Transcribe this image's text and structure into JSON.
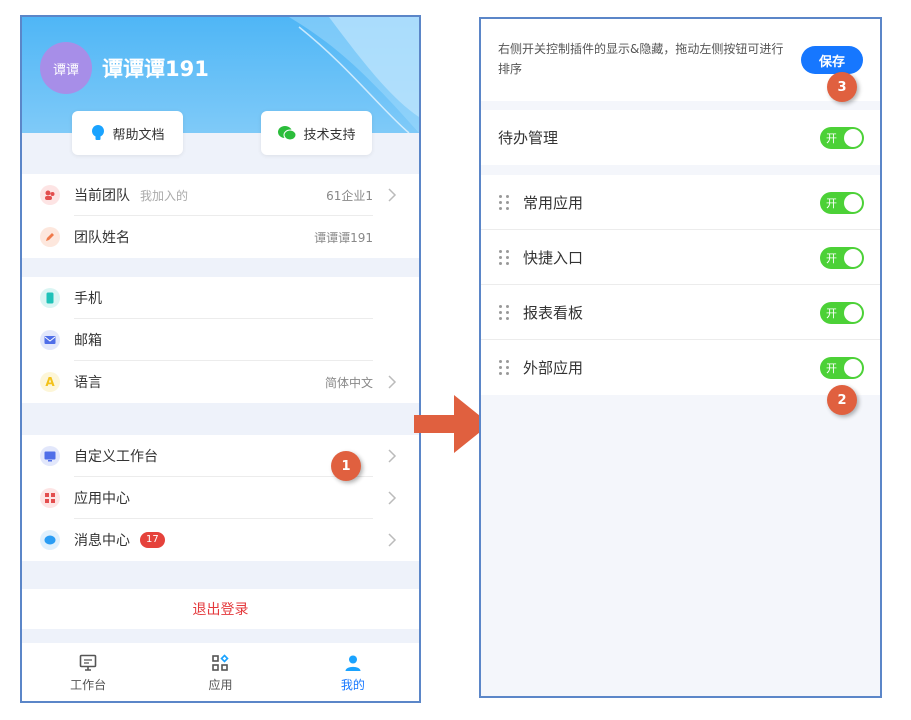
{
  "left": {
    "user": {
      "avatar_text": "谭谭",
      "name": "谭谭谭191"
    },
    "help": {
      "docs": "帮助文档",
      "support": "技术支持"
    },
    "team": [
      {
        "label": "当前团队",
        "sub": "我加入的",
        "value": "61企业1"
      },
      {
        "label": "团队姓名",
        "value": "谭谭谭191"
      }
    ],
    "contact": [
      {
        "label": "手机"
      },
      {
        "label": "邮箱"
      },
      {
        "label": "语言",
        "value": "简体中文"
      }
    ],
    "apps": [
      {
        "label": "自定义工作台"
      },
      {
        "label": "应用中心"
      },
      {
        "label": "消息中心",
        "badge": "17"
      }
    ],
    "logout": "退出登录",
    "tabs": [
      {
        "label": "工作台",
        "icon": "monitor-icon"
      },
      {
        "label": "应用",
        "icon": "grid-icon"
      },
      {
        "label": "我的",
        "icon": "user-icon",
        "active": true
      }
    ]
  },
  "markers": {
    "m1": "1",
    "m2": "2",
    "m3": "3"
  },
  "right": {
    "desc": "右侧开关控制插件的显示&隐藏，拖动左侧按钮可进行排序",
    "save": "保存",
    "todo": {
      "label": "待办管理",
      "toggle": "开"
    },
    "plugins": [
      {
        "label": "常用应用",
        "toggle": "开"
      },
      {
        "label": "快捷入口",
        "toggle": "开"
      },
      {
        "label": "报表看板",
        "toggle": "开"
      },
      {
        "label": "外部应用",
        "toggle": "开"
      }
    ]
  },
  "colors": {
    "accent": "#1677ff",
    "toggle_on": "#4cd137",
    "marker": "#e0603f",
    "danger": "#e4393c"
  }
}
